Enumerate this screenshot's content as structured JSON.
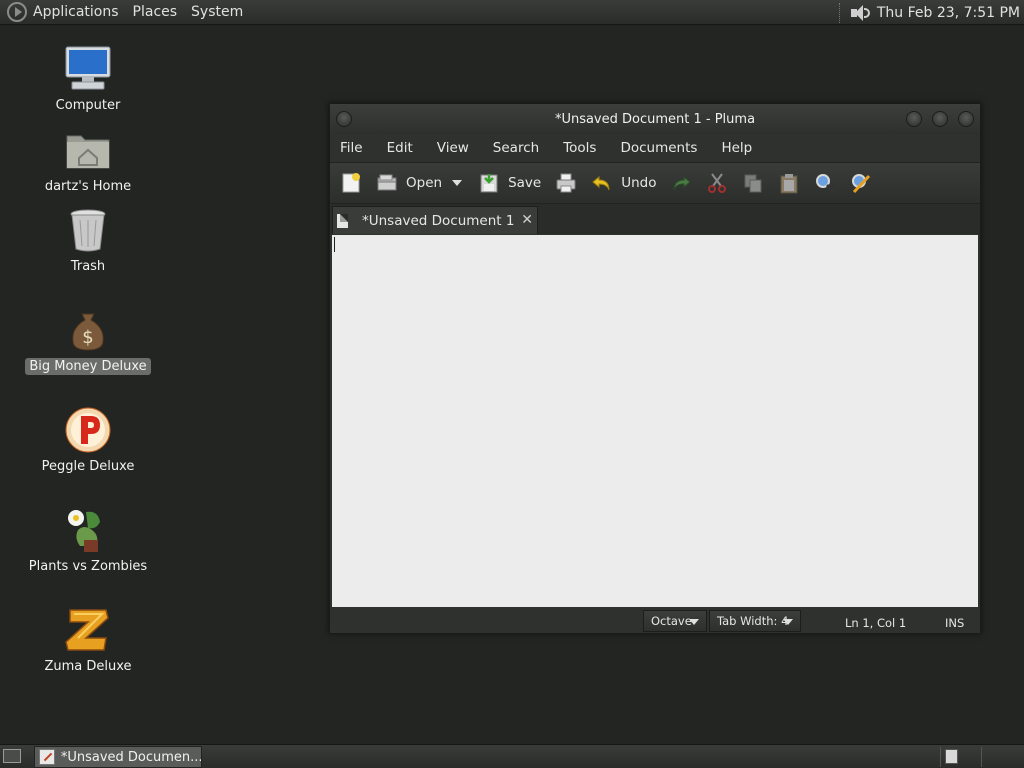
{
  "top_panel": {
    "menus": [
      "Applications",
      "Places",
      "System"
    ],
    "clock": "Thu Feb 23,  7:51 PM"
  },
  "desktop_icons": [
    {
      "label": "Computer",
      "icon": "computer-icon"
    },
    {
      "label": "dartz's Home",
      "icon": "home-folder-icon"
    },
    {
      "label": "Trash",
      "icon": "trash-icon"
    },
    {
      "label": "Big Money Deluxe",
      "icon": "money-bag-icon",
      "selected": true
    },
    {
      "label": "Peggle Deluxe",
      "icon": "peggle-icon"
    },
    {
      "label": "Plants vs Zombies",
      "icon": "plants-vs-zombies-icon"
    },
    {
      "label": "Zuma Deluxe",
      "icon": "zuma-icon"
    }
  ],
  "window": {
    "title": "*Unsaved Document 1 - Pluma",
    "menus": [
      "File",
      "Edit",
      "View",
      "Search",
      "Tools",
      "Documents",
      "Help"
    ],
    "toolbar": {
      "open_label": "Open",
      "save_label": "Save",
      "undo_label": "Undo"
    },
    "tab_label": "*Unsaved Document 1",
    "tab_close": "✕",
    "status": {
      "language": "Octave",
      "tab_width": "Tab Width:  4",
      "position": "Ln 1, Col 1",
      "mode": "INS"
    }
  },
  "taskbar": {
    "task_label": "*Unsaved Documen..."
  },
  "colors": {
    "desktop_bg": "#232522",
    "editor_bg": "#ececec",
    "selection": "#6b6d6b"
  }
}
